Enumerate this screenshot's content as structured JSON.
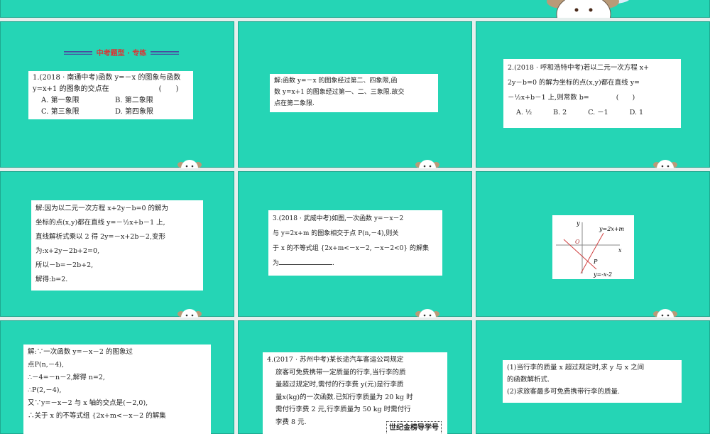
{
  "header": {
    "mascot": "mascot-illustration"
  },
  "slides": [
    {
      "title": "中考题型 · 专练",
      "lines": [
        "1.(2018 · 南通中考)函数 y=－x 的图象与函数",
        "y=x+1 的图象的交点在　　　　　　　(　　)"
      ],
      "options": [
        "A. 第一象限",
        "B. 第二象限",
        "C. 第三象限",
        "D. 第四象限"
      ]
    },
    {
      "lines": [
        "解:函数 y=－x 的图象经过第二、四象限,函",
        "数 y=x+1 的图象经过第一、二、三象限.故交",
        "点在第二象限."
      ]
    },
    {
      "lines": [
        "2.(2018 · 呼和浩特中考)若以二元一次方程 x+",
        "2y－b=0 的解为坐标的点(x,y)都在直线 y=",
        "－½x+b－1 上,则常数 b=　　　　(　　)"
      ],
      "options": [
        "A. ½",
        "B. 2",
        "C. －1",
        "D. 1"
      ]
    },
    {
      "lines": [
        "解:因为以二元一次方程 x+2y－b=0 的解为",
        "坐标的点(x,y)都在直线 y=－½x+b－1 上,",
        "直线解析式乘以 2 得 2y=－x+2b－2,变形",
        "为:x+2y－2b+2=0,",
        "所以－b=－2b+2,",
        "解得:b=2."
      ]
    },
    {
      "lines": [
        "3.(2018 · 武威中考)如图,一次函数 y=－x－2",
        "与 y=2x+m 的图象相交于点 P(n,－4),则关",
        "于 x 的不等式组 {2x+m<－x－2, －x－2<0} 的解集",
        "为"
      ],
      "end": "."
    },
    {
      "figure": {
        "y_label": "y",
        "x_label": "x",
        "origin": "O",
        "point": "P",
        "line1": "y=2x+m",
        "line2": "y=-x-2"
      }
    },
    {
      "lines": [
        "解:∵一次函数 y=－x－2 的图象过",
        "点P(n,－4),",
        "∴－4=－n－2,解得 n=2,",
        "∴P(2,－4),",
        "又∵y=－x－2 与 x 轴的交点是(－2,0),",
        "∴关于 x 的不等式组 {2x+m<－x－2 的解集"
      ]
    },
    {
      "lines": [
        "4.(2017 · 苏州中考)某长途汽车客运公司规定",
        "旅客可免费携带一定质量的行李,当行李的质",
        "量超过规定时,需付的行李费 y(元)是行李质",
        "量x(kg)的一次函数.已知行李质量为 20 kg 时",
        "需付行李费 2 元,行李质量为 50 kg 时需付行",
        "李费 8 元."
      ],
      "badge": "世纪金榜导学号"
    },
    {
      "lines": [
        "(1)当行李的质量 x 超过规定时,求 y 与 x 之间",
        "的函数解析式.",
        "(2)求旅客最多可免费携带行李的质量."
      ]
    }
  ]
}
